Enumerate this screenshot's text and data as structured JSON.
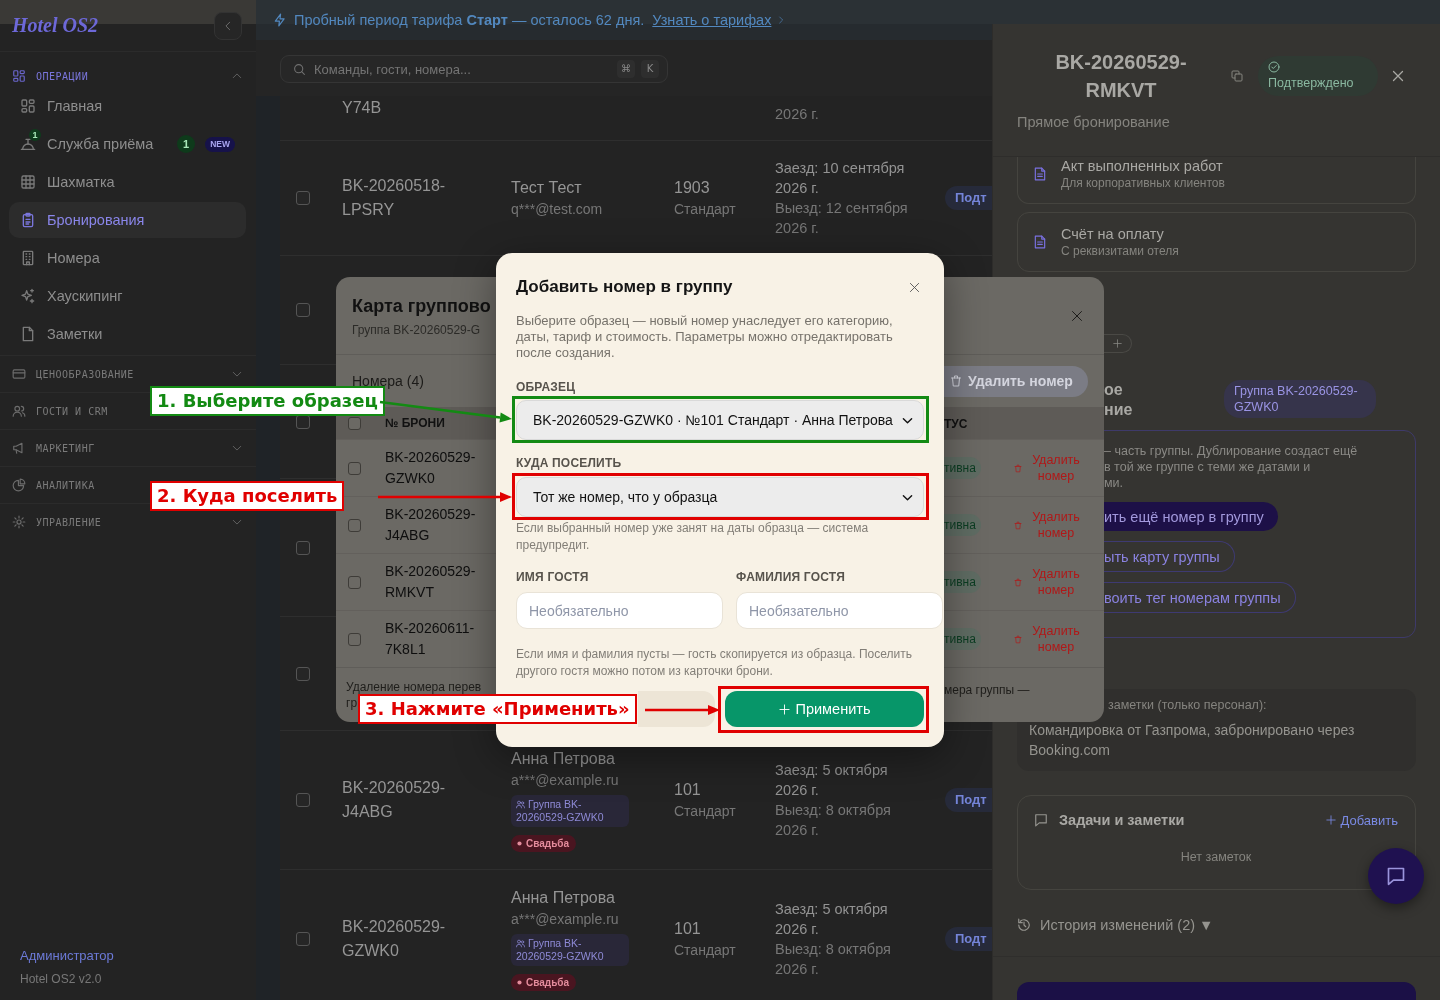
{
  "sidebar": {
    "logo": "Hotel OS2",
    "sections": [
      {
        "title": "ОПЕРАЦИИ",
        "expanded": true,
        "items": [
          {
            "label": "Главная",
            "selected": false
          },
          {
            "label": "Служба приёма",
            "selected": false,
            "icon_badge": "1",
            "count": "1",
            "tag": "NEW"
          },
          {
            "label": "Шахматка",
            "selected": false
          },
          {
            "label": "Бронирования",
            "selected": true
          },
          {
            "label": "Номера",
            "selected": false
          },
          {
            "label": "Хаускипинг",
            "selected": false
          },
          {
            "label": "Заметки",
            "selected": false
          }
        ]
      },
      {
        "title": "ЦЕНООБРАЗОВАНИЕ",
        "expanded": false
      },
      {
        "title": "ГОСТИ И CRM",
        "expanded": false
      },
      {
        "title": "МАРКЕТИНГ",
        "expanded": false
      },
      {
        "title": "АНАЛИТИКА",
        "expanded": false
      },
      {
        "title": "УПРАВЛЕНИЕ",
        "expanded": false
      }
    ],
    "footer": {
      "role": "Администратор",
      "version": "Hotel OS2 v2.0"
    }
  },
  "banner": {
    "text": "Пробный период тарифа **Старт** — осталось 62 дня.",
    "link": "Узнать о тарифах"
  },
  "search": {
    "placeholder": "Команды, гости, номера...",
    "keys": [
      "⌘",
      "K"
    ]
  },
  "bookings": {
    "cut_row": {
      "number": "Y74B",
      "checkout": "2026 г."
    },
    "rows": [
      {
        "checked": false,
        "number": "BK-20260518-LPSRY",
        "guest": "Тест Тест",
        "email": "q***@test.com",
        "room": "1903",
        "category": "Стандарт",
        "checkin": "Заезд: 10 сентября 2026 г.",
        "checkout": "Выезд: 12 сентября 2026 г.",
        "status": "Подт"
      },
      {
        "checked": false
      },
      {
        "checked": false
      },
      {
        "checked": false
      },
      {
        "checked": false
      },
      {
        "checked": false,
        "number": "BK-20260529-J4ABG",
        "guest": "Анна Петрова",
        "email": "a***@example.ru",
        "group": "Группа BK-20260529-GZWK0",
        "tag": "Свадьба",
        "room": "101",
        "category": "Стандарт",
        "checkin": "Заезд: 5 октября 2026 г.",
        "checkout": "Выезд: 8 октября 2026 г.",
        "status": "Подт"
      },
      {
        "checked": false,
        "number": "BK-20260529-GZWK0",
        "guest": "Анна Петрова",
        "email": "a***@example.ru",
        "group": "Группа BK-20260529-GZWK0",
        "tag": "Свадьба",
        "room": "101",
        "category": "Стандарт",
        "checkin": "Заезд: 5 октября 2026 г.",
        "checkout": "Выезд: 8 октября 2026 г.",
        "status": "Подт"
      }
    ]
  },
  "booking_drawer": {
    "title": "BK-20260529-RMKVT",
    "status": "Подтверждено",
    "source": "Прямое бронирование",
    "documents": [
      {
        "title": "Акт выполненных работ",
        "subtitle": "Для корпоративных клиентов"
      },
      {
        "title": "Счёт на оплату",
        "subtitle": "С реквизитами отеля"
      }
    ],
    "group_heading": [
      "ое",
      "ние"
    ],
    "group_badge": "Группа BK-20260529-GZWK0",
    "group_note": [
      "– часть группы. Дублирование создаст ещё",
      "в той же группе с теми же датами и",
      "ми."
    ],
    "group_actions": [
      {
        "label": "ить ещё номер в группу",
        "kind": "primary"
      },
      {
        "label": "ыть карту группы",
        "kind": "outline"
      },
      {
        "label": "воить тег номерам группы",
        "kind": "outline"
      }
    ],
    "notes_label": "заметки (только персонал):",
    "notes_text": "Командировка от Газпрома, забронировано через Booking.com",
    "tasks": {
      "title": "Задачи и заметки",
      "add": "Добавить",
      "empty": "Нет заметок"
    },
    "history": "История изменений (2) ▼"
  },
  "group_card": {
    "title": "Карта группово",
    "subtitle": "Группа BK-20260529-G",
    "rooms_heading": "Номера (4)",
    "delete_button": "Удалить номер",
    "all_checked": false,
    "columns": [
      "№ БРОНИ",
      "ТУС"
    ],
    "rows": [
      {
        "checked": false,
        "number": "BK-20260529-GZWK0",
        "status": "тивна",
        "action": "Удалить номер"
      },
      {
        "checked": false,
        "number": "BK-20260529-J4ABG",
        "status": "тивна",
        "action": "Удалить номер"
      },
      {
        "checked": false,
        "number": "BK-20260529-RMKVT",
        "status": "тивна",
        "action": "Удалить номер"
      },
      {
        "checked": false,
        "number": "BK-20260611-7K8L1",
        "status": "тивна",
        "action": "Удалить номер"
      }
    ],
    "footer_left": [
      "Удаление номера перев",
      "гр"
    ],
    "footer_right": "мера группы —"
  },
  "add_room_dialog": {
    "title": "Добавить номер в группу",
    "description": "Выберите образец — новый номер унаследует его категорию, даты, тариф и стоимость. Параметры можно отредактировать после создания.",
    "fields": [
      {
        "kind": "select",
        "label": "ОБРАЗЕЦ",
        "value": "BK-20260529-GZWK0 · №101 Стандарт · Анна Петрова"
      },
      {
        "kind": "select",
        "label": "КУДА ПОСЕЛИТЬ",
        "value": "Тот же номер, что у образца",
        "hint": "Если выбранный номер уже занят на даты образца — система предупредит."
      }
    ],
    "name_fields": [
      {
        "label": "ИМЯ ГОСТЯ",
        "placeholder": "Необязательно"
      },
      {
        "label": "ФАМИЛИЯ ГОСТЯ",
        "placeholder": "Необязательно"
      }
    ],
    "name_hint": "Если имя и фамилия пусты — гость скопируется из образца. Поселить другого гостя можно потом из карточки брони.",
    "apply_button": "Применить"
  },
  "annotations": [
    {
      "label": "1. Выберите образец",
      "color": "#138a13"
    },
    {
      "label": "2. Куда поселить",
      "color": "#e00000"
    },
    {
      "label": "3. Нажмите «Применить»",
      "color": "#e00000"
    }
  ]
}
